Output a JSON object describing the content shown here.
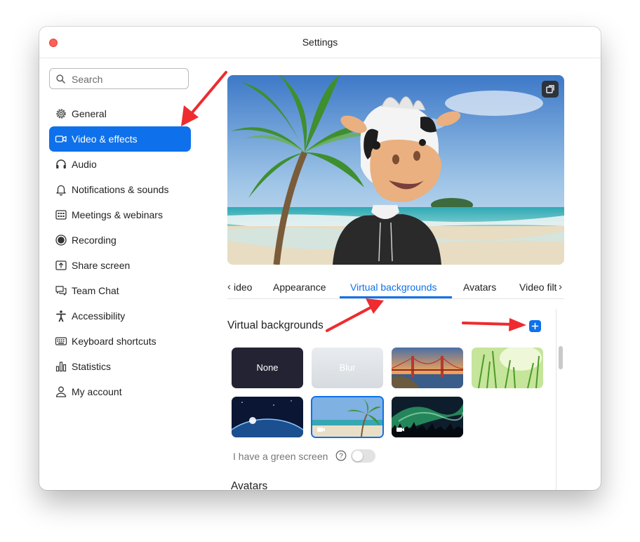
{
  "window": {
    "title": "Settings"
  },
  "search": {
    "placeholder": "Search"
  },
  "sidebar": {
    "items": [
      {
        "label": "General",
        "icon": "gear-icon"
      },
      {
        "label": "Video & effects",
        "icon": "video-camera-icon",
        "active": true
      },
      {
        "label": "Audio",
        "icon": "headphones-icon"
      },
      {
        "label": "Notifications & sounds",
        "icon": "bell-icon"
      },
      {
        "label": "Meetings & webinars",
        "icon": "calendar-grid-icon"
      },
      {
        "label": "Recording",
        "icon": "record-icon"
      },
      {
        "label": "Share screen",
        "icon": "share-screen-icon"
      },
      {
        "label": "Team Chat",
        "icon": "chat-icon"
      },
      {
        "label": "Accessibility",
        "icon": "accessibility-icon"
      },
      {
        "label": "Keyboard shortcuts",
        "icon": "keyboard-icon"
      },
      {
        "label": "Statistics",
        "icon": "bar-chart-icon"
      },
      {
        "label": "My account",
        "icon": "person-icon"
      }
    ]
  },
  "tabs": {
    "items": [
      "ideo",
      "Appearance",
      "Virtual backgrounds",
      "Avatars",
      "Video filt"
    ],
    "active": "Virtual backgrounds"
  },
  "virtual_backgrounds": {
    "title": "Virtual backgrounds",
    "thumbnails": [
      {
        "label": "None"
      },
      {
        "label": "Blur"
      },
      {
        "label": ""
      },
      {
        "label": ""
      },
      {
        "label": ""
      },
      {
        "label": "",
        "selected": true
      },
      {
        "label": ""
      }
    ],
    "green_screen_label": "I have a green screen",
    "green_screen_enabled": false
  },
  "avatars": {
    "title": "Avatars"
  },
  "colors": {
    "accent": "#0e71eb",
    "close": "#fe5f57",
    "annotation": "#ee2b2f"
  }
}
